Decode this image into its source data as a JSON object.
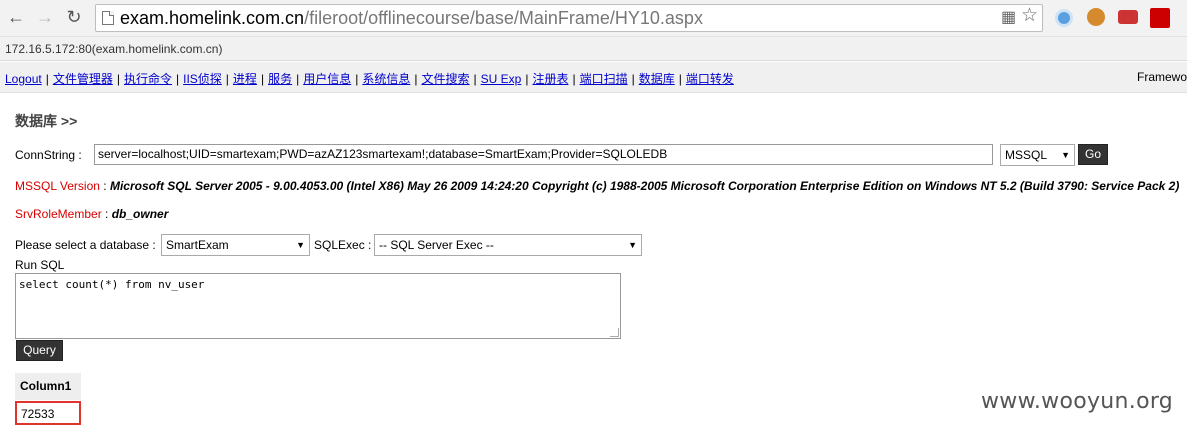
{
  "browser": {
    "url_host": "exam.homelink.com.cn",
    "url_path": "/fileroot/offlinecourse/base/MainFrame/HY10.aspx",
    "status_text": "172.16.5.172:80(exam.homelink.com.cn)",
    "icons": [
      "back-icon",
      "forward-icon",
      "reload-icon",
      "page-icon",
      "translate-icon",
      "star-icon",
      "extension-icons"
    ]
  },
  "menu": {
    "items": [
      "Logout",
      "文件管理器",
      "执行命令",
      "IIS侦探",
      "进程",
      "服务",
      "用户信息",
      "系统信息",
      "文件搜索",
      "SU Exp",
      "注册表",
      "端口扫描",
      "数据库",
      "端口转发"
    ],
    "framework": "Framewo"
  },
  "content": {
    "title": "数据库 >>",
    "conn_label": "ConnString :",
    "conn_value": "server=localhost;UID=smartexam;PWD=azAZ123smartexam!;database=SmartExam;Provider=SQLOLEDB",
    "db_type": "MSSQL",
    "go_label": "Go",
    "version_label": "MSSQL Version",
    "version_sep": " : ",
    "version_value": "Microsoft SQL Server 2005 - 9.00.4053.00 (Intel X86) May 26 2009 14:24:20 Copyright (c) 1988-2005 Microsoft Corporation Enterprise Edition on Windows NT 5.2 (Build 3790: Service Pack 2)",
    "role_label": "SrvRoleMember",
    "role_sep": " : ",
    "role_value": "db_owner",
    "select_db_label": "Please select a database :",
    "database_selected": "SmartExam",
    "sqlexec_label": "SQLExec :",
    "sqlexec_selected": "-- SQL Server Exec --",
    "run_sql_label": "Run SQL",
    "sql_text": "select count(*) from nv_user",
    "query_label": "Query",
    "result_header": "Column1",
    "result_value": "72533"
  },
  "watermark": "www.wooyun.org",
  "colors": {
    "label_red": "#d60000",
    "link_blue": "#0000cc",
    "highlight_box": "#e0332b"
  }
}
